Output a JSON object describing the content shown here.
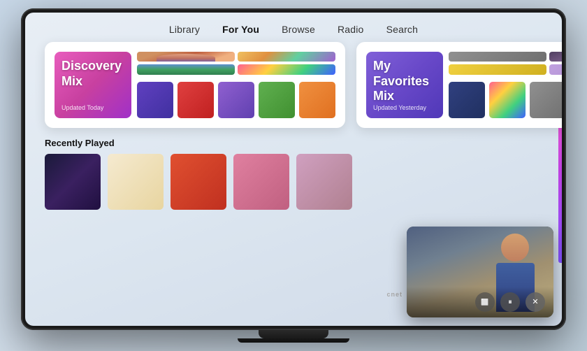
{
  "nav": {
    "items": [
      {
        "label": "Library",
        "active": false
      },
      {
        "label": "For You",
        "active": true
      },
      {
        "label": "Browse",
        "active": false
      },
      {
        "label": "Radio",
        "active": false
      },
      {
        "label": "Search",
        "active": false
      }
    ]
  },
  "discovery_mix": {
    "title": "Discovery Mix",
    "subtitle": "Updated Today"
  },
  "favorites_mix": {
    "title": "My Favorites Mix",
    "subtitle": "Updated Yesterday"
  },
  "recently_played": {
    "label": "Recently Played"
  },
  "video": {
    "source": "cnet"
  },
  "controls": {
    "airplay": "⬜",
    "pause": "⏸",
    "close": "✕"
  }
}
